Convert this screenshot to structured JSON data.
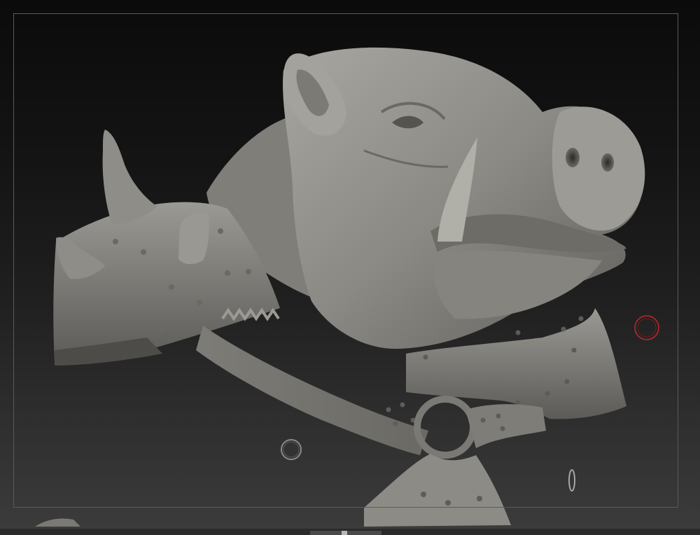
{
  "viewport": {
    "background_top": "#0b0b0b",
    "background_bottom": "#3c3c3c",
    "frame_color": "#5a5a5a"
  },
  "model": {
    "subject": "boar-head-sculpt",
    "material_color": "#8a8984",
    "shadow_color": "#4a4945",
    "highlight_color": "#b4b3ad"
  },
  "cursors": {
    "brush_cursor_color": "#c0282d",
    "secondary_cursor_color": "#8a8a86"
  },
  "icons": [
    "brush-cursor-icon",
    "secondary-cursor-icon",
    "pivot-marker-icon"
  ]
}
